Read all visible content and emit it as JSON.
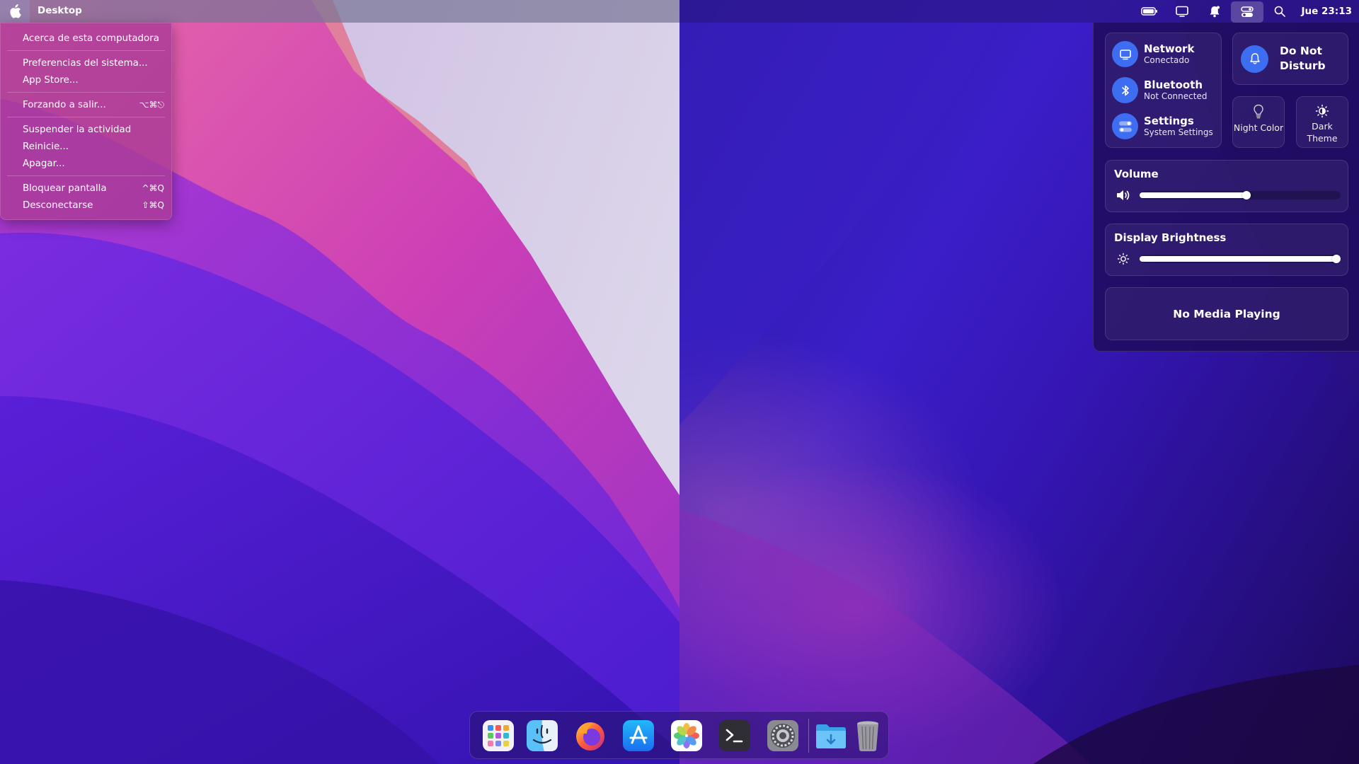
{
  "menubar": {
    "app_title": "Desktop",
    "clock": "Jue 23:13",
    "status_icons": [
      "battery-icon",
      "display-icon",
      "notification-icon",
      "control-center-icon",
      "search-icon"
    ]
  },
  "apple_menu": {
    "items": [
      {
        "label": "Acerca de esta computadora",
        "shortcut": ""
      },
      {
        "label": "Preferencias del sistema...",
        "shortcut": ""
      },
      {
        "label": "App Store...",
        "shortcut": ""
      },
      {
        "label": "Forzando a salir...",
        "shortcut": "⌥⌘⎋"
      },
      {
        "label": "Suspender la actividad",
        "shortcut": ""
      },
      {
        "label": "Reinicie...",
        "shortcut": ""
      },
      {
        "label": "Apagar...",
        "shortcut": ""
      },
      {
        "label": "Bloquear pantalla",
        "shortcut": "^⌘Q"
      },
      {
        "label": "Desconectarse",
        "shortcut": "⇧⌘Q"
      }
    ]
  },
  "control_center": {
    "network": {
      "title": "Network",
      "status": "Conectado"
    },
    "bluetooth": {
      "title": "Bluetooth",
      "status": "Not Connected"
    },
    "settings": {
      "title": "Settings",
      "status": "System Settings"
    },
    "do_not_disturb": {
      "label": "Do Not Disturb"
    },
    "night_color": {
      "label": "Night Color"
    },
    "dark_theme": {
      "label": "Dark Theme"
    },
    "volume": {
      "title": "Volume",
      "level": 0.53
    },
    "brightness": {
      "title": "Display Brightness",
      "level": 1.0
    },
    "media": {
      "label": "No Media Playing"
    }
  },
  "dock": {
    "items": [
      "launchpad-icon",
      "finder-icon",
      "firefox-icon",
      "app-store-icon",
      "photos-icon",
      "terminal-icon",
      "system-preferences-icon",
      "downloads-folder-icon",
      "trash-icon"
    ]
  },
  "colors": {
    "accent": "#3d6ef2",
    "menu_bg": "#aa3c96",
    "panel_bg": "#1e0c5a"
  }
}
